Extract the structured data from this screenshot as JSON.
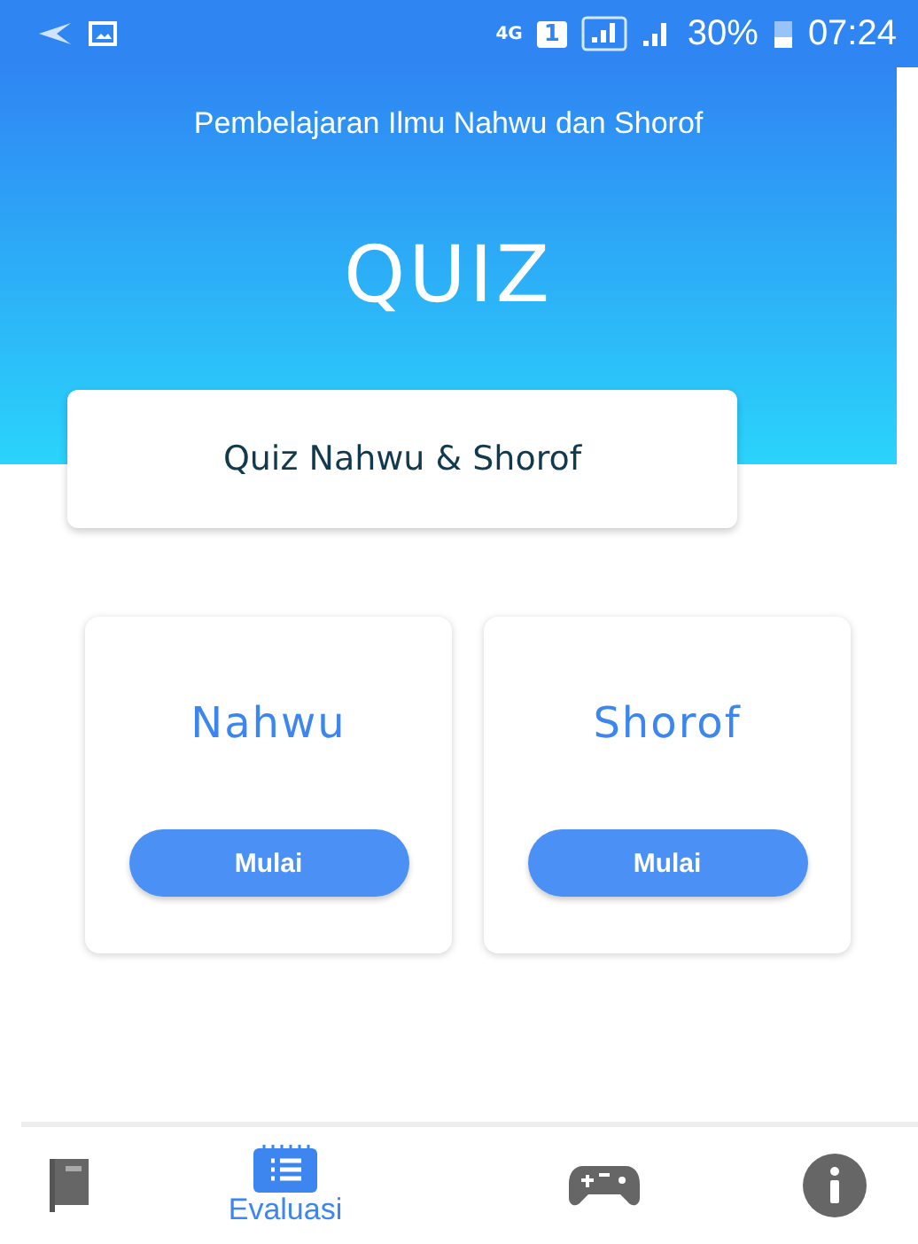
{
  "status_bar": {
    "network": "4G",
    "sim": "1",
    "battery": "30%",
    "time": "07:24"
  },
  "header": {
    "subtitle": "Pembelajaran Ilmu Nahwu dan Shorof",
    "title": "QUIZ"
  },
  "banner": {
    "label": "Quiz Nahwu & Shorof"
  },
  "cards": [
    {
      "title": "Nahwu",
      "button": "Mulai"
    },
    {
      "title": "Shorof",
      "button": "Mulai"
    }
  ],
  "bottom_nav": [
    {
      "kind": "book",
      "selected": false
    },
    {
      "kind": "list",
      "label": "Evaluasi",
      "selected": true
    },
    {
      "kind": "gamepad",
      "selected": false
    },
    {
      "kind": "info",
      "selected": false
    }
  ]
}
